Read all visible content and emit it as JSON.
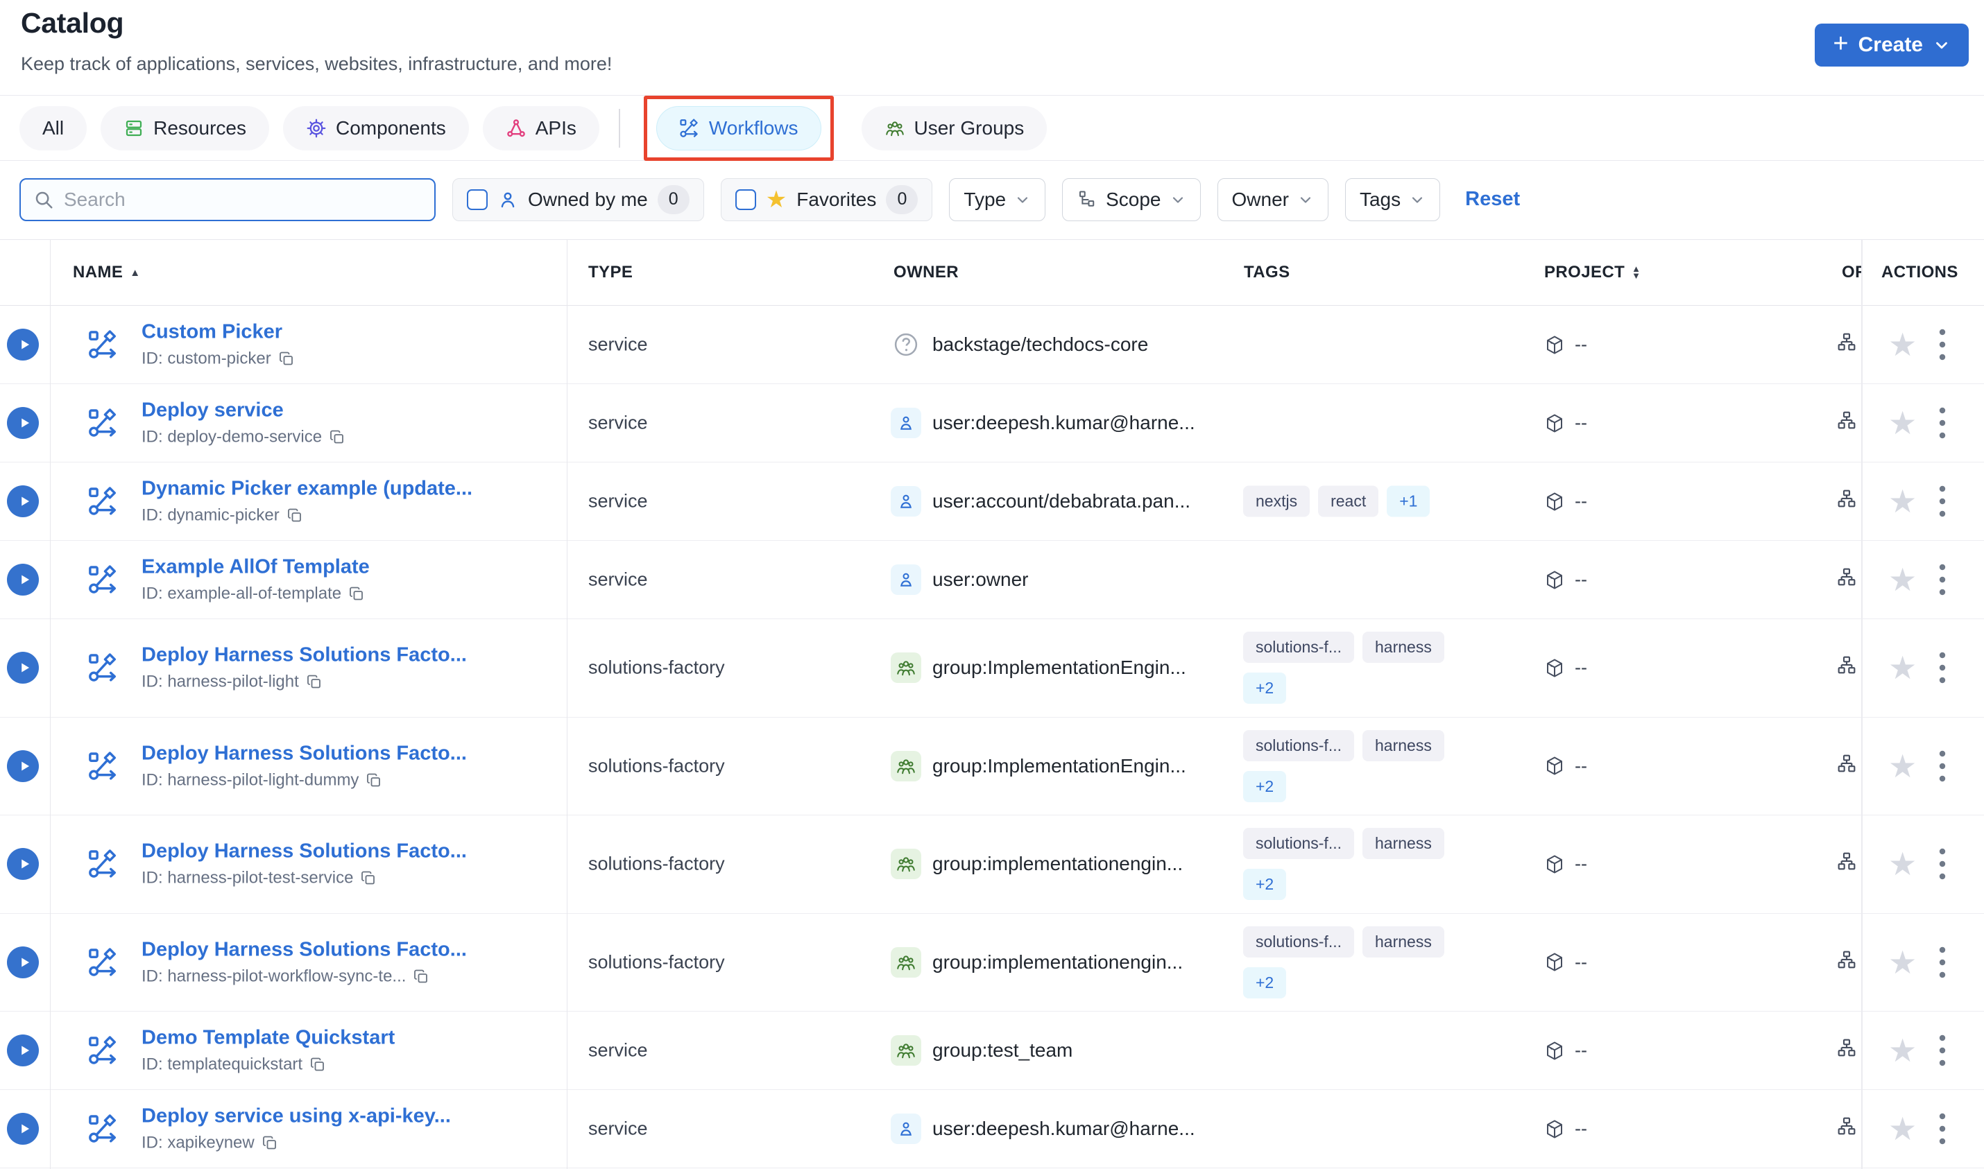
{
  "page": {
    "title": "Catalog",
    "subtitle": "Keep track of applications, services, websites, infrastructure, and more!"
  },
  "create_button": {
    "label": "Create"
  },
  "annotation": {
    "type": "highlight-box",
    "target": "Workflows",
    "color": "#e8432d"
  },
  "tabs": [
    {
      "label": "All",
      "icon": null,
      "active": false
    },
    {
      "label": "Resources",
      "icon": "resources",
      "active": false
    },
    {
      "label": "Components",
      "icon": "components",
      "active": false
    },
    {
      "label": "APIs",
      "icon": "apis",
      "active": false,
      "divider_after": true
    },
    {
      "label": "Workflows",
      "icon": "workflows",
      "active": true,
      "annotated": true
    },
    {
      "label": "User Groups",
      "icon": "user-groups",
      "active": false
    }
  ],
  "filters": {
    "search_placeholder": "Search",
    "owned_by_me": {
      "label": "Owned by me",
      "count": "0",
      "checked": false
    },
    "favorites": {
      "label": "Favorites",
      "count": "0",
      "checked": false
    },
    "dropdowns": [
      {
        "label": "Type",
        "icon": null
      },
      {
        "label": "Scope",
        "icon": "hierarchy"
      },
      {
        "label": "Owner",
        "icon": null
      },
      {
        "label": "Tags",
        "icon": null
      }
    ],
    "reset_label": "Reset"
  },
  "table": {
    "columns": {
      "name": "NAME",
      "type": "TYPE",
      "owner": "OWNER",
      "tags": "TAGS",
      "project": "PROJECT",
      "org": "OR",
      "actions": "ACTIONS"
    },
    "project_placeholder": "--",
    "rows": [
      {
        "name": "Custom Picker",
        "id_label": "ID: custom-picker",
        "type": "service",
        "owner": {
          "kind": "unknown",
          "text": "backstage/techdocs-core"
        },
        "tags": [],
        "project": "--",
        "tall": false
      },
      {
        "name": "Deploy service",
        "id_label": "ID: deploy-demo-service",
        "type": "service",
        "owner": {
          "kind": "user",
          "text": "user:deepesh.kumar@harne..."
        },
        "tags": [],
        "project": "--",
        "tall": false
      },
      {
        "name": "Dynamic Picker example (update...",
        "id_label": "ID: dynamic-picker",
        "type": "service",
        "owner": {
          "kind": "user",
          "text": "user:account/debabrata.pan..."
        },
        "tags": [
          {
            "label": "nextjs",
            "more": false
          },
          {
            "label": "react",
            "more": false
          },
          {
            "label": "+1",
            "more": true
          }
        ],
        "project": "--",
        "tall": false
      },
      {
        "name": "Example AllOf Template",
        "id_label": "ID: example-all-of-template",
        "type": "service",
        "owner": {
          "kind": "user",
          "text": "user:owner"
        },
        "tags": [],
        "project": "--",
        "tall": false
      },
      {
        "name": "Deploy Harness Solutions Facto...",
        "id_label": "ID: harness-pilot-light",
        "type": "solutions-factory",
        "owner": {
          "kind": "group",
          "text": "group:ImplementationEngin..."
        },
        "tags": [
          {
            "label": "solutions-f...",
            "more": false
          },
          {
            "label": "harness",
            "more": false
          },
          {
            "label": "+2",
            "more": true
          }
        ],
        "project": "--",
        "tall": true
      },
      {
        "name": "Deploy Harness Solutions Facto...",
        "id_label": "ID: harness-pilot-light-dummy",
        "type": "solutions-factory",
        "owner": {
          "kind": "group",
          "text": "group:ImplementationEngin..."
        },
        "tags": [
          {
            "label": "solutions-f...",
            "more": false
          },
          {
            "label": "harness",
            "more": false
          },
          {
            "label": "+2",
            "more": true
          }
        ],
        "project": "--",
        "tall": true
      },
      {
        "name": "Deploy Harness Solutions Facto...",
        "id_label": "ID: harness-pilot-test-service",
        "type": "solutions-factory",
        "owner": {
          "kind": "group",
          "text": "group:implementationengin..."
        },
        "tags": [
          {
            "label": "solutions-f...",
            "more": false
          },
          {
            "label": "harness",
            "more": false
          },
          {
            "label": "+2",
            "more": true
          }
        ],
        "project": "--",
        "tall": true
      },
      {
        "name": "Deploy Harness Solutions Facto...",
        "id_label": "ID: harness-pilot-workflow-sync-te...",
        "type": "solutions-factory",
        "owner": {
          "kind": "group",
          "text": "group:implementationengin..."
        },
        "tags": [
          {
            "label": "solutions-f...",
            "more": false
          },
          {
            "label": "harness",
            "more": false
          },
          {
            "label": "+2",
            "more": true
          }
        ],
        "project": "--",
        "tall": true
      },
      {
        "name": "Demo Template Quickstart",
        "id_label": "ID: templatequickstart",
        "type": "service",
        "owner": {
          "kind": "group",
          "text": "group:test_team"
        },
        "tags": [],
        "project": "--",
        "tall": false
      },
      {
        "name": "Deploy service using x-api-key...",
        "id_label": "ID: xapikeynew",
        "type": "service",
        "owner": {
          "kind": "user",
          "text": "user:deepesh.kumar@harne..."
        },
        "tags": [],
        "project": "--",
        "tall": false
      }
    ]
  },
  "colors": {
    "accent_blue": "#2e6fd4",
    "annotation_red": "#e8432d",
    "active_tab_bg": "#e9f8fe",
    "tag_bg": "#f1f1f6",
    "more_tag_bg": "#e8f7fd",
    "favorite_star_gray": "#d6d9e1",
    "favorites_filter_star_yellow": "#f4c12f"
  }
}
